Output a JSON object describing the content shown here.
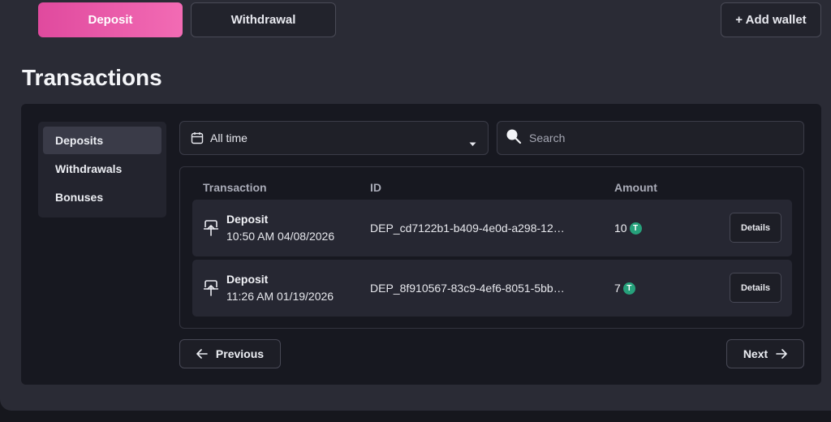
{
  "top_buttons": {
    "deposit": "Deposit",
    "withdrawal": "Withdrawal",
    "add_wallet": "+ Add wallet"
  },
  "page_title": "Transactions",
  "sidebar": {
    "items": [
      {
        "label": "Deposits",
        "active": true
      },
      {
        "label": "Withdrawals",
        "active": false
      },
      {
        "label": "Bonuses",
        "active": false
      }
    ]
  },
  "filter": {
    "selected": "All time",
    "icon": "calendar-icon"
  },
  "search": {
    "placeholder": "Search",
    "value": ""
  },
  "table": {
    "headers": [
      "Transaction",
      "ID",
      "Amount"
    ],
    "rows": [
      {
        "type": "Deposit",
        "datetime": "10:50 AM 04/08/2026",
        "id": "DEP_cd7122b1-b409-4e0d-a298-12…",
        "amount": "10",
        "currency_icon": "T",
        "action": "Details"
      },
      {
        "type": "Deposit",
        "datetime": "11:26 AM 01/19/2026",
        "id": "DEP_8f910567-83c9-4ef6-8051-5bb…",
        "amount": "7",
        "currency_icon": "T",
        "action": "Details"
      }
    ]
  },
  "pagination": {
    "previous": "Previous",
    "next": "Next"
  },
  "colors": {
    "accent_start": "#e04a9e",
    "accent_end": "#f26bb4",
    "tether_green": "#26a17b",
    "panel": "#2a2b35",
    "card": "#171820"
  }
}
